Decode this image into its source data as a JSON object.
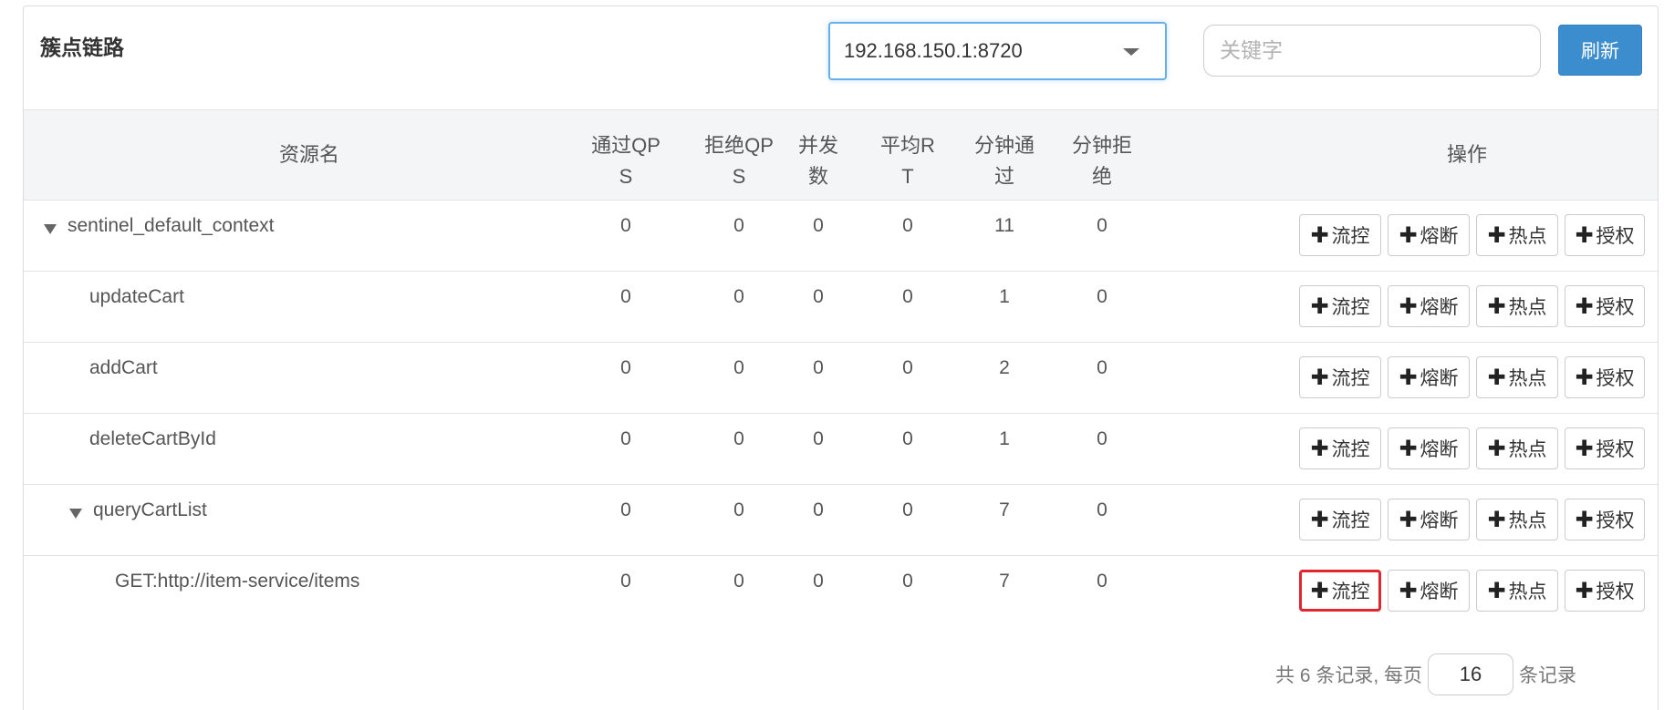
{
  "panel": {
    "title": "簇点链路"
  },
  "toolbar": {
    "machine_select_value": "192.168.150.1:8720",
    "search_placeholder": "关键字",
    "search_value": "",
    "refresh_label": "刷新"
  },
  "table": {
    "headers": {
      "resource": "资源名",
      "pass_qps": "通过QP\nS",
      "block_qps": "拒绝QP\nS",
      "concurrency": "并发\n数",
      "avg_rt": "平均R\nT",
      "minute_pass": "分钟通\n过",
      "minute_block": "分钟拒\n绝",
      "ops": "操作"
    },
    "rows": [
      {
        "name": "sentinel_default_context",
        "expanded": true,
        "pass_qps": "0",
        "block_qps": "0",
        "concurrency": "0",
        "avg_rt": "0",
        "minute_pass": "11",
        "minute_block": "0"
      },
      {
        "name": "updateCart",
        "pass_qps": "0",
        "block_qps": "0",
        "concurrency": "0",
        "avg_rt": "0",
        "minute_pass": "1",
        "minute_block": "0"
      },
      {
        "name": "addCart",
        "pass_qps": "0",
        "block_qps": "0",
        "concurrency": "0",
        "avg_rt": "0",
        "minute_pass": "2",
        "minute_block": "0"
      },
      {
        "name": "deleteCartById",
        "pass_qps": "0",
        "block_qps": "0",
        "concurrency": "0",
        "avg_rt": "0",
        "minute_pass": "1",
        "minute_block": "0"
      },
      {
        "name": "queryCartList",
        "expanded": true,
        "pass_qps": "0",
        "block_qps": "0",
        "concurrency": "0",
        "avg_rt": "0",
        "minute_pass": "7",
        "minute_block": "0"
      },
      {
        "name": "GET:http://item-service/items",
        "pass_qps": "0",
        "block_qps": "0",
        "concurrency": "0",
        "avg_rt": "0",
        "minute_pass": "7",
        "minute_block": "0",
        "highlighted_action": "flow"
      }
    ],
    "actions": {
      "plus_glyph": "✚",
      "flow": "流控",
      "degrade": "熔断",
      "hotspot": "热点",
      "authority": "授权"
    }
  },
  "pagination": {
    "total_prefix": "共 6 条记录, 每页",
    "page_size": "16",
    "suffix": "条记录"
  },
  "colors": {
    "primary": "#3c8dce",
    "focus_border": "#66afe9",
    "highlight": "#e0262e",
    "header_bg": "#f4f5f7"
  }
}
